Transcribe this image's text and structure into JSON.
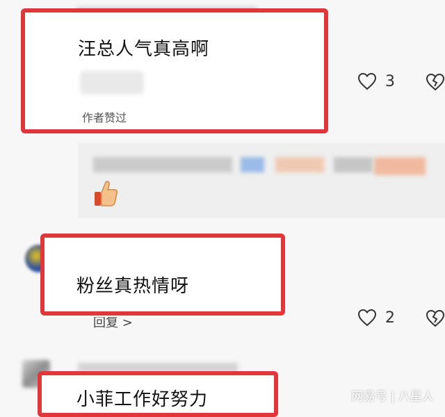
{
  "comments": [
    {
      "text": "汪总人气真高啊",
      "badge": "作者赞过",
      "likes": "3"
    },
    {
      "text": "粉丝真热情呀",
      "reply_link": "回复 >",
      "likes": "2"
    },
    {
      "text": "小菲工作好努力"
    }
  ],
  "watermark": "网易号 | 八星人",
  "colors": {
    "highlight_border": "#e0373b",
    "background": "#f7f7f7"
  }
}
